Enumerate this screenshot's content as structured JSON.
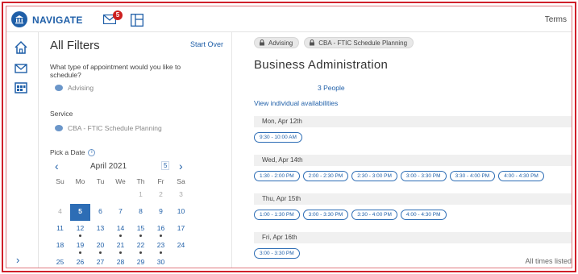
{
  "app": {
    "brand": "NAVIGATE",
    "mail_badge": "5",
    "terms_label": "Terms"
  },
  "filters": {
    "title": "All Filters",
    "start_over": "Start Over",
    "question": "What type of appointment would you like to schedule?",
    "appointment_type": "Advising",
    "service_label": "Service",
    "service_value": "CBA - FTIC Schedule Planning",
    "pick_date_label": "Pick a Date"
  },
  "calendar": {
    "month": "April 2021",
    "badge": "5",
    "weekdays": [
      "Su",
      "Mo",
      "Tu",
      "We",
      "Th",
      "Fr",
      "Sa"
    ],
    "weeks": [
      [
        {
          "d": "",
          "s": "muted"
        },
        {
          "d": "",
          "s": "muted"
        },
        {
          "d": "",
          "s": "muted"
        },
        {
          "d": "",
          "s": "muted"
        },
        {
          "d": "1",
          "s": "muted"
        },
        {
          "d": "2",
          "s": "muted"
        },
        {
          "d": "3",
          "s": "muted"
        }
      ],
      [
        {
          "d": "4",
          "s": "muted"
        },
        {
          "d": "5",
          "s": "sel"
        },
        {
          "d": "6",
          "s": ""
        },
        {
          "d": "7",
          "s": ""
        },
        {
          "d": "8",
          "s": ""
        },
        {
          "d": "9",
          "s": ""
        },
        {
          "d": "10",
          "s": ""
        }
      ],
      [
        {
          "d": "11",
          "s": ""
        },
        {
          "d": "12",
          "s": "avail"
        },
        {
          "d": "13",
          "s": ""
        },
        {
          "d": "14",
          "s": "avail"
        },
        {
          "d": "15",
          "s": "avail"
        },
        {
          "d": "16",
          "s": "avail"
        },
        {
          "d": "17",
          "s": ""
        }
      ],
      [
        {
          "d": "18",
          "s": ""
        },
        {
          "d": "19",
          "s": "avail"
        },
        {
          "d": "20",
          "s": "avail"
        },
        {
          "d": "21",
          "s": "avail"
        },
        {
          "d": "22",
          "s": "avail"
        },
        {
          "d": "23",
          "s": "avail"
        },
        {
          "d": "24",
          "s": ""
        }
      ],
      [
        {
          "d": "25",
          "s": ""
        },
        {
          "d": "26",
          "s": "avail"
        },
        {
          "d": "27",
          "s": ""
        },
        {
          "d": "28",
          "s": ""
        },
        {
          "d": "29",
          "s": ""
        },
        {
          "d": "30",
          "s": ""
        },
        {
          "d": "",
          "s": ""
        }
      ]
    ]
  },
  "main": {
    "chips": [
      "Advising",
      "CBA - FTIC Schedule Planning"
    ],
    "title": "Business Administration",
    "people": "3 People",
    "view_availabilities": "View individual availabilities",
    "days": [
      {
        "label": "Mon, Apr 12th",
        "slots": [
          "9:30 - 10:00 AM"
        ]
      },
      {
        "label": "Wed, Apr 14th",
        "slots": [
          "1:30 - 2:00 PM",
          "2:00 - 2:30 PM",
          "2:30 - 3:00 PM",
          "3:00 - 3:30 PM",
          "3:30 - 4:00 PM",
          "4:00 - 4:30 PM"
        ]
      },
      {
        "label": "Thu, Apr 15th",
        "slots": [
          "1:00 - 1:30 PM",
          "3:00 - 3:30 PM",
          "3:30 - 4:00 PM",
          "4:00 - 4:30 PM"
        ]
      },
      {
        "label": "Fri, Apr 16th",
        "slots": [
          "3:00 - 3:30 PM"
        ]
      }
    ],
    "all_times": "All times listed"
  }
}
